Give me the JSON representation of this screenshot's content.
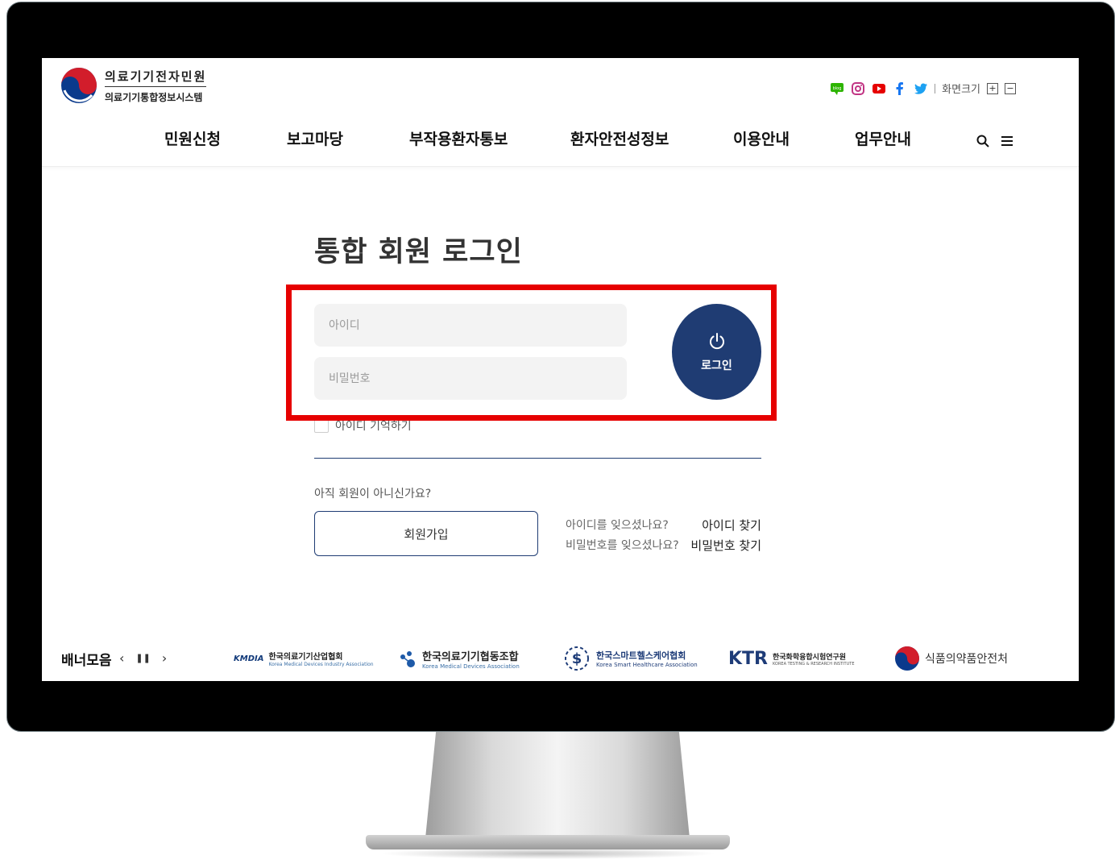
{
  "header": {
    "logo": {
      "line1": "의료기기전자민원",
      "line2": "의료기기통합정보시스템"
    },
    "sns": {
      "icons": [
        "blog-icon",
        "instagram-icon",
        "youtube-icon",
        "facebook-icon",
        "twitter-icon"
      ],
      "font_size_label": "화면크기",
      "plus": "+",
      "minus": "−"
    },
    "nav": [
      "민원신청",
      "보고마당",
      "부작용환자통보",
      "환자안전성정보",
      "이용안내",
      "업무안내"
    ]
  },
  "login": {
    "title": "통합 회원 로그인",
    "id_placeholder": "아이디",
    "pw_placeholder": "비밀번호",
    "login_label": "로그인",
    "remember_label": "아이디 기억하기",
    "not_member": "아직 회원이 아니신가요?",
    "join_label": "회원가입",
    "forgot_id_q": "아이디를 잊으셨나요?",
    "forgot_id_link": "아이디 찾기",
    "forgot_pw_q": "비밀번호를 잊으셨나요?",
    "forgot_pw_link": "비밀번호 찾기"
  },
  "banners": {
    "title": "배너모음",
    "prev": "‹",
    "pause": "❚❚",
    "next": "›",
    "items": [
      {
        "mark": "KMDIA",
        "main": "한국의료기기산업협회",
        "sub": "Korea Medical Devices Industry Association"
      },
      {
        "main": "한국의료기기협동조합",
        "sub": "Korea Medical Devices Association"
      },
      {
        "main": "한국스마트헬스케어협회",
        "sub": "Korea Smart Healthcare Association"
      },
      {
        "mark": "KTR",
        "main": "한국화학융합시험연구원",
        "sub": "KOREA TESTING & RESEARCH INSTITUTE"
      },
      {
        "main": "식품의약품안전처"
      }
    ]
  },
  "colors": {
    "navy": "#1f3c73",
    "highlight": "#e60000",
    "field_bg": "#f3f3f3"
  }
}
